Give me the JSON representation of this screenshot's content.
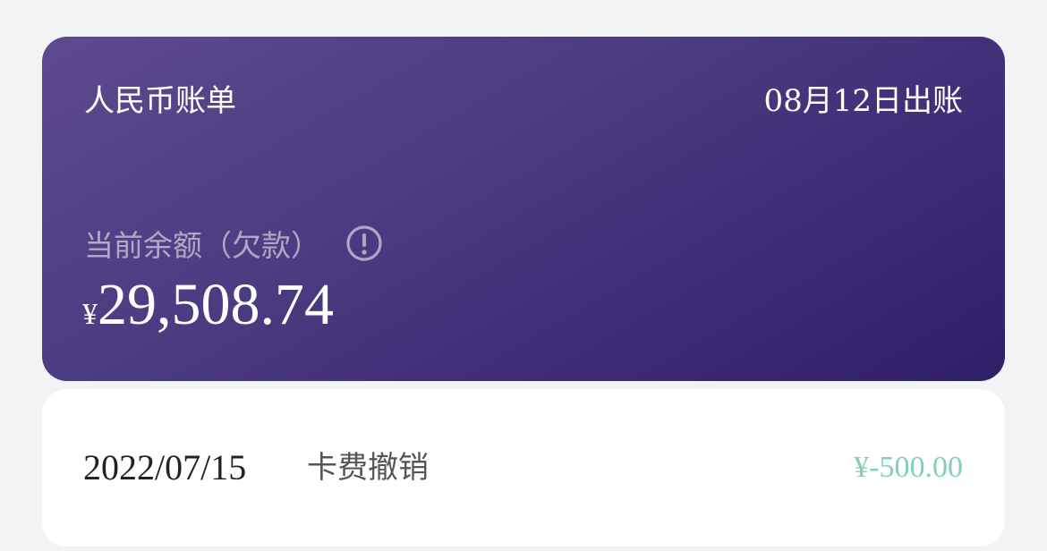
{
  "bill_card": {
    "title": "人民币账单",
    "statement_date": "08月12日出账",
    "balance_label": "当前余额（欠款）",
    "balance_currency": "¥",
    "balance_amount": "29,508.74",
    "info_icon": "info-icon"
  },
  "transactions": [
    {
      "date": "2022/07/15",
      "description": "卡费撤销",
      "amount": "¥-500.00",
      "amount_color": "#84d0b6"
    }
  ],
  "colors": {
    "card_gradient_start": "#5e4a8f",
    "card_gradient_end": "#2f1f66",
    "page_background": "#f2f3f5",
    "refund_amount": "#84d0b6"
  }
}
